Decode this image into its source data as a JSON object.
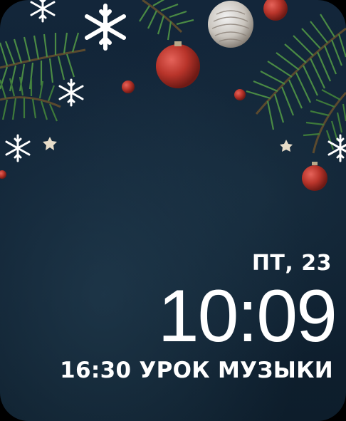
{
  "watch_face": {
    "date": "ПТ, 23",
    "time": "10:09",
    "event": "16:30 УРОК МУЗЫКИ"
  },
  "wallpaper": {
    "theme": "christmas",
    "background_color": "#11243a",
    "ornament_color": "#b8342a",
    "pine_color": "#3f7a3c",
    "snowflake_color": "#ffffff"
  }
}
